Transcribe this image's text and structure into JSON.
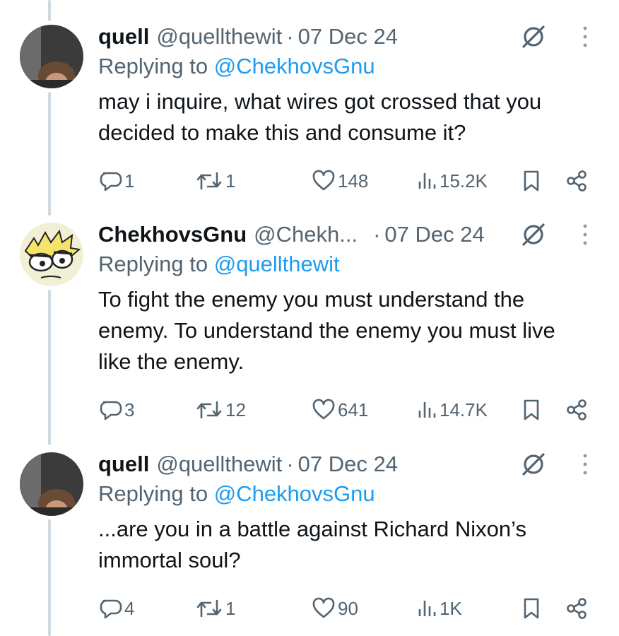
{
  "tweets": [
    {
      "name": "quell",
      "handle": "@quellthewit",
      "sep": "·",
      "date": "07 Dec 24",
      "replying_prefix": "Replying to ",
      "replying_to": "@ChekhovsGnu",
      "text": "may i inquire, what wires got crossed that you decided to make this and consume it?",
      "replies": "1",
      "retweets": "1",
      "likes": "148",
      "views": "15.2K"
    },
    {
      "name": "ChekhovsGnu",
      "handle": "@Chekh...",
      "sep": "·",
      "date": "07 Dec 24",
      "replying_prefix": "Replying to ",
      "replying_to": "@quellthewit",
      "text": "To fight the enemy you must understand the enemy. To understand the enemy you must live like the enemy.",
      "replies": "3",
      "retweets": "12",
      "likes": "641",
      "views": "14.7K"
    },
    {
      "name": "quell",
      "handle": "@quellthewit",
      "sep": "·",
      "date": "07 Dec 24",
      "replying_prefix": "Replying to ",
      "replying_to": "@ChekhovsGnu",
      "text": "...are you in a battle against Richard Nixon’s immortal soul?",
      "replies": "4",
      "retweets": "1",
      "likes": "90",
      "views": "1K"
    }
  ],
  "icons": {
    "reply": "reply-icon",
    "retweet": "retweet-icon",
    "like": "heart-icon",
    "views": "views-icon",
    "bookmark": "bookmark-icon",
    "share": "share-icon",
    "grok": "grok-icon",
    "more": "more-icon"
  },
  "colors": {
    "text": "#0f1419",
    "secondary": "#536471",
    "link": "#1d9bf0",
    "thread_line": "#cfd9de"
  }
}
